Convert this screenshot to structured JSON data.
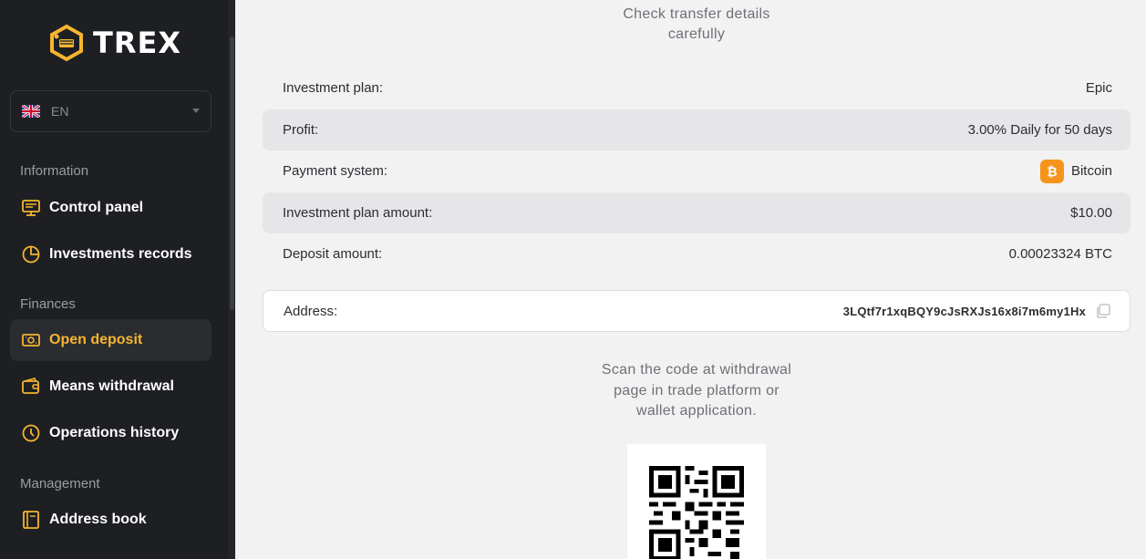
{
  "brand": {
    "name": "TREX",
    "accent": "#f6b530"
  },
  "language": {
    "code": "EN",
    "flag": "uk-flag-icon"
  },
  "sidebar": {
    "sections": [
      {
        "label": "Information"
      },
      {
        "label": "Finances"
      },
      {
        "label": "Management"
      }
    ],
    "items": [
      {
        "label": "Control panel",
        "icon": "dashboard-icon"
      },
      {
        "label": "Investments records",
        "icon": "pie-chart-icon"
      },
      {
        "label": "Open deposit",
        "icon": "cash-icon",
        "active": true
      },
      {
        "label": "Means withdrawal",
        "icon": "wallet-icon"
      },
      {
        "label": "Operations history",
        "icon": "clock-icon"
      },
      {
        "label": "Address book",
        "icon": "book-icon"
      }
    ]
  },
  "main": {
    "heading_line1": "Check transfer details",
    "heading_line2": "carefully",
    "details": [
      {
        "label": "Investment plan:",
        "value": "Epic"
      },
      {
        "label": "Profit:",
        "value": "3.00% Daily for 50 days"
      },
      {
        "label": "Payment system:",
        "value": "Bitcoin",
        "icon": "bitcoin-icon"
      },
      {
        "label": "Investment plan amount:",
        "value": "$10.00"
      },
      {
        "label": "Deposit amount:",
        "value": "0.00023324 BTC"
      }
    ],
    "address": {
      "label": "Address:",
      "value": "3LQtf7r1xqBQY9cJsRXJs16x8i7m6my1Hx"
    },
    "scan_line1": "Scan the code at withdrawal",
    "scan_line2": "page in trade platform or",
    "scan_line3": "wallet application."
  }
}
